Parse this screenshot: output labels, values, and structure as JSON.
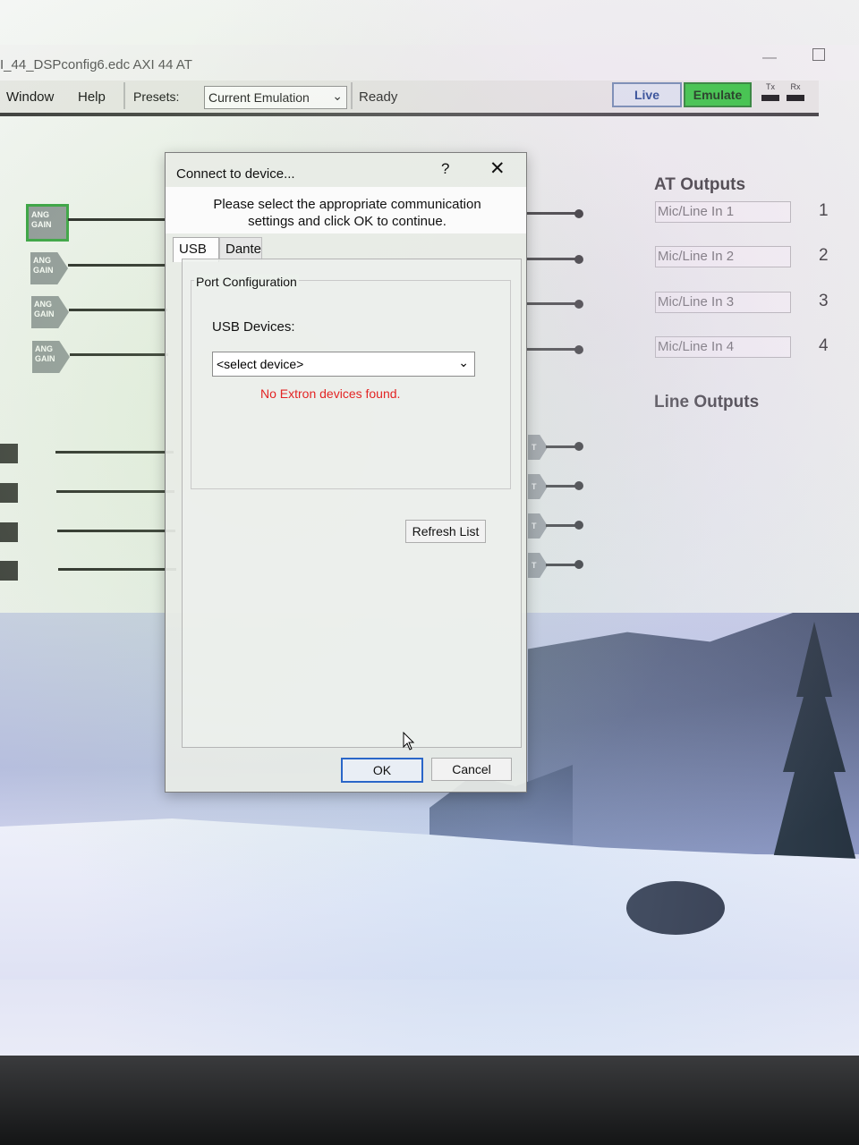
{
  "window": {
    "title": "I_44_DSPconfig6.edc  AXI 44 AT",
    "minimize_glyph": "—"
  },
  "menu": {
    "window_label": "Window",
    "help_label": "Help",
    "presets_label": "Presets:",
    "preset_value": "Current Emulation",
    "status": "Ready",
    "live_label": "Live",
    "emulate_label": "Emulate",
    "tx_label": "Tx",
    "rx_label": "Rx"
  },
  "canvas": {
    "gain_label": "ANG GAIN",
    "at_outputs_heading": "AT Outputs",
    "line_outputs_heading": "Line Outputs",
    "outputs": [
      {
        "label": "Mic/Line In 1",
        "number": "1"
      },
      {
        "label": "Mic/Line In 2",
        "number": "2"
      },
      {
        "label": "Mic/Line In 3",
        "number": "3"
      },
      {
        "label": "Mic/Line In 4",
        "number": "4"
      }
    ],
    "small_block_label": "T"
  },
  "dialog": {
    "title": "Connect to device...",
    "help_glyph": "?",
    "close_glyph": "✕",
    "instruction": "Please select the appropriate communication settings and click OK to continue.",
    "tabs": [
      {
        "label": "USB",
        "active": true
      },
      {
        "label": "Dante",
        "active": false
      }
    ],
    "group_label": "Port Configuration",
    "usb_devices_label": "USB Devices:",
    "device_value": "<select device>",
    "error_text": "No Extron devices found.",
    "refresh_label": "Refresh List",
    "ok_label": "OK",
    "cancel_label": "Cancel"
  },
  "colors": {
    "emulate_active": "#2fc53a",
    "live_accent": "#1b3f8c",
    "error": "#e32424",
    "ok_focus": "#2a66c8"
  }
}
